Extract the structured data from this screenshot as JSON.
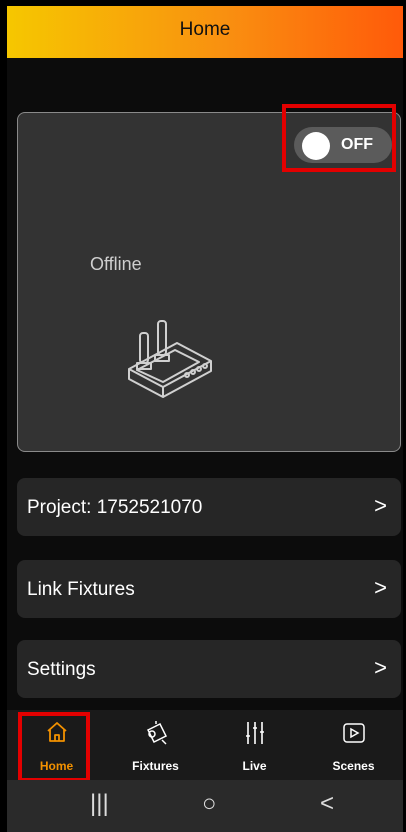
{
  "header": {
    "title": "Home"
  },
  "device": {
    "status": "Offline",
    "power_toggle": {
      "label": "OFF",
      "state": "off"
    }
  },
  "rows": {
    "project": "Project: 1752521070",
    "link_fixtures": "Link Fixtures",
    "settings": "Settings",
    "chevron": ">"
  },
  "tabs": [
    {
      "label": "Home",
      "icon": "home-icon",
      "active": true
    },
    {
      "label": "Fixtures",
      "icon": "fixture-icon",
      "active": false
    },
    {
      "label": "Live",
      "icon": "sliders-icon",
      "active": false
    },
    {
      "label": "Scenes",
      "icon": "play-icon",
      "active": false
    }
  ],
  "system_nav": {
    "recents": "|||",
    "home": "○",
    "back": "<"
  },
  "colors": {
    "header_gradient_start": "#f6c700",
    "header_gradient_end": "#ff5a0a",
    "active_tab": "#f29100",
    "highlight": "#e30000"
  }
}
